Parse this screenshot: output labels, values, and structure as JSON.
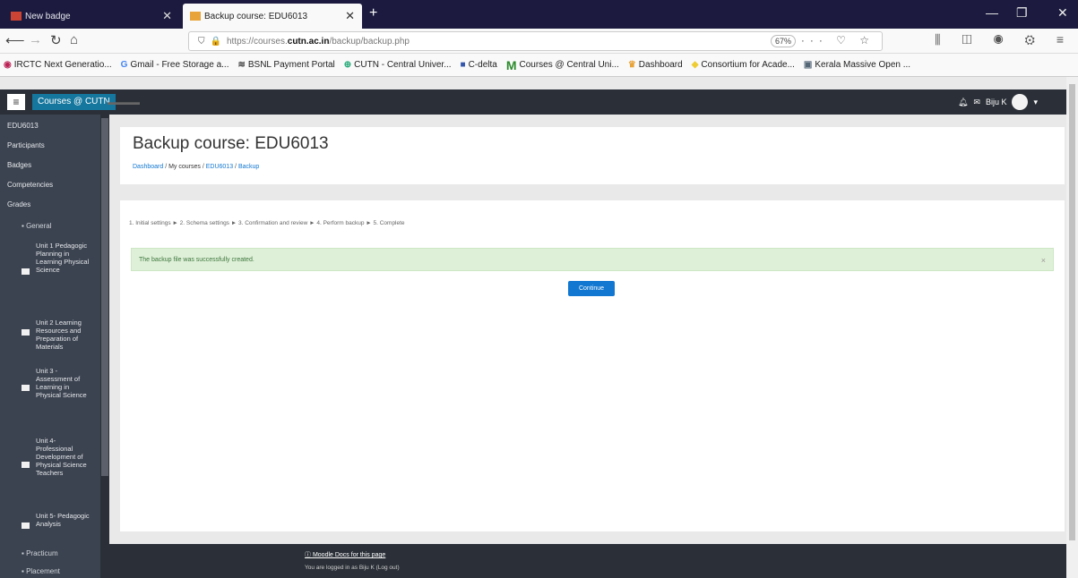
{
  "browser": {
    "tabs": [
      {
        "title": "New badge"
      },
      {
        "title": "Backup course: EDU6013"
      }
    ],
    "url_prefix": "https://courses.",
    "url_domain": "cutn.ac.in",
    "url_path": "/backup/backup.php",
    "zoom": "67%",
    "bookmarks": [
      "IRCTC Next Generatio...",
      "Gmail - Free Storage a...",
      "BSNL Payment Portal",
      "CUTN - Central Univer...",
      "C-delta",
      "Courses @ Central Uni...",
      "Dashboard",
      "Consortium for Acade...",
      "Kerala Massive Open ..."
    ]
  },
  "moodle": {
    "brand": "Courses @ CUTN",
    "user": "Biju K"
  },
  "sidebar": {
    "items": [
      "EDU6013",
      "Participants",
      "Badges",
      "Competencies",
      "Grades",
      "General"
    ],
    "sections": [
      "Unit 1 Pedagogic Planning in Learning Physical Science",
      "Unit 2 Learning Resources and Preparation of Materials",
      "Unit 3 - Assessment of Learning in Physical Science",
      "Unit 4- Professional Development of Physical Science Teachers",
      "Unit 5- Pedagogic Analysis"
    ],
    "bottom": [
      "Practicum",
      "Placement"
    ]
  },
  "page": {
    "title": "Backup course: EDU6013",
    "breadcrumb": [
      "Dashboard",
      "My courses",
      "EDU6013",
      "Backup"
    ],
    "steps": "1. Initial settings ► 2. Schema settings ► 3. Confirmation and review ► 4. Perform backup ► 5. Complete",
    "alert": "The backup file was successfully created.",
    "continue": "Continue"
  },
  "footer": {
    "docs_link": "Moodle Docs for this page",
    "logged_in": "You are logged in as Biju K (Log out)"
  },
  "colors": {
    "moodle_nav": "#2b3038",
    "sidebar": "#3c4350",
    "brand": "#15779e",
    "primary_button": "#1177d1",
    "alert_bg": "#dff0d8"
  }
}
